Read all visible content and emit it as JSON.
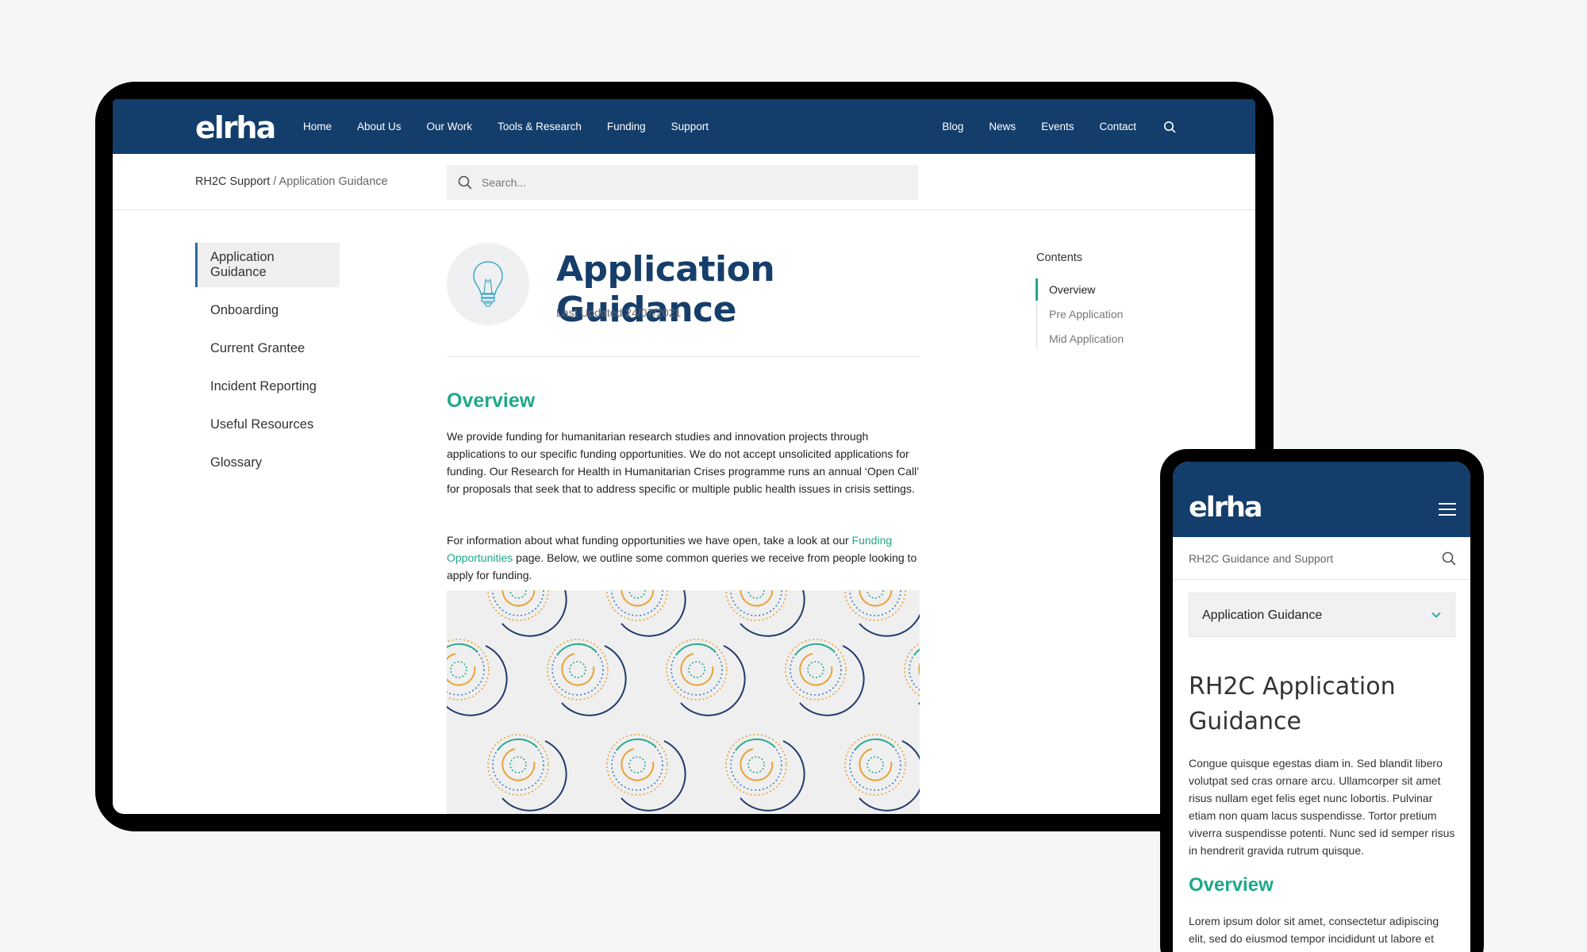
{
  "brand": {
    "logo_text": "elrha",
    "navy": "#133d6b",
    "teal": "#1ea88a"
  },
  "desktop": {
    "nav": {
      "primary": [
        "Home",
        "About Us",
        "Our Work",
        "Tools & Research",
        "Funding",
        "Support"
      ],
      "secondary": [
        "Blog",
        "News",
        "Events",
        "Contact"
      ]
    },
    "breadcrumb": {
      "parent": "RH2C Support",
      "current": "/ Application Guidance"
    },
    "search": {
      "placeholder": "Search..."
    },
    "sidebar": [
      "Application Guidance",
      "Onboarding",
      "Current Grantee",
      "Incident Reporting",
      "Useful Resources",
      "Glossary"
    ],
    "page": {
      "title": "Application Guidance",
      "updated": "Last Updated 24/07/2021",
      "section_title": "Overview",
      "para1": "We provide funding for humanitarian research studies and innovation projects through applications to our specific funding opportunities. We do not accept unsolicited applications for funding. Our Research for Health in Humanitarian Crises programme runs an annual ‘Open Call’ for proposals that seek that to address specific or multiple public health issues in crisis settings.",
      "para2_before": "For information about what funding opportunities we have open, take a look at our ",
      "para2_link": "Funding Opportunities",
      "para2_after": " page. Below, we outline some common queries we receive from people looking to apply for funding."
    },
    "toc": {
      "heading": "Contents",
      "items": [
        "Overview",
        "Pre Application",
        "Mid Application"
      ]
    }
  },
  "mobile": {
    "subheader": "RH2C Guidance and Support",
    "select_value": "Application Guidance",
    "title": "RH2C Application Guidance",
    "para1": "Congue quisque egestas diam in. Sed blandit libero volutpat sed cras ornare arcu. Ullamcorper sit amet risus nullam eget felis eget nunc lobortis. Pulvinar etiam non quam lacus suspendisse. Tortor pretium viverra suspendisse potenti. Nunc sed id semper risus in hendrerit gravida rutrum quisque.",
    "section_title": "Overview",
    "para2": "Lorem ipsum dolor sit amet, consectetur adipiscing elit, sed do eiusmod tempor incididunt ut labore et dolore magna aliqua. Gravida utrum quisque non"
  },
  "icons": {
    "search": "search-icon",
    "bulb": "lightbulb-icon",
    "menu": "hamburger-menu-icon",
    "chevron": "chevron-down-icon"
  }
}
